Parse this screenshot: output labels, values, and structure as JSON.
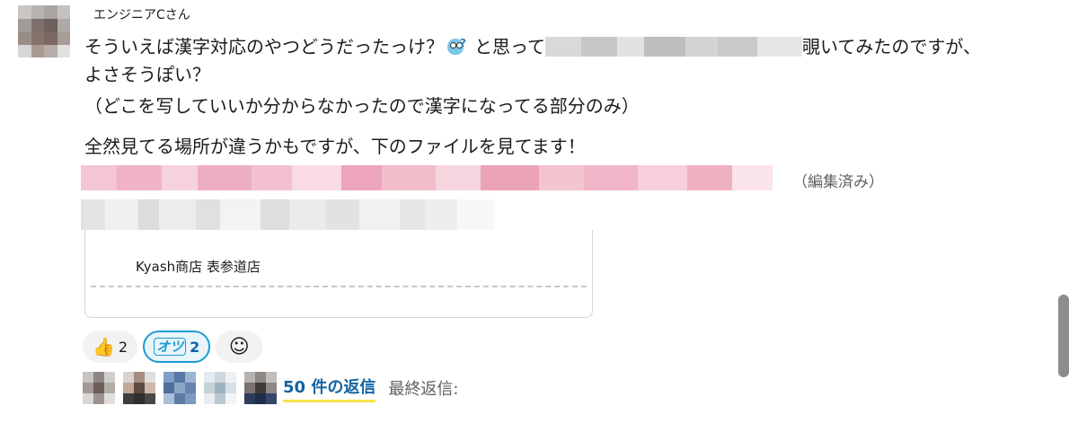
{
  "message": {
    "author": "エンジニアCさん",
    "line1_before": "そういえば漢字対応のやつどうだったっけ？",
    "line1_mid": "と思って",
    "line1_after": "覗いてみたのですが、",
    "line2": "よさそうぽい？",
    "line3": "（どこを写していいか分からなかったので漢字になってる部分のみ）",
    "line4": "全然見てる場所が違うかもですが、下のファイルを見てます！",
    "edited_label": "（編集済み）"
  },
  "attachment": {
    "title": "Kyash商店 表参道店"
  },
  "reactions": [
    {
      "icon": "thumbs-up-icon",
      "glyph": "👍",
      "count": "2",
      "active": false
    },
    {
      "icon": "otsu-icon",
      "glyph": "オツ",
      "count": "2",
      "active": true
    }
  ],
  "replies": {
    "count_label": "50 件の返信",
    "last_reply_label": "最終返信:"
  },
  "colors": {
    "link": "#1264a3",
    "reaction_active_border": "#1d9bd1",
    "underline_highlight": "#f5e44a"
  }
}
